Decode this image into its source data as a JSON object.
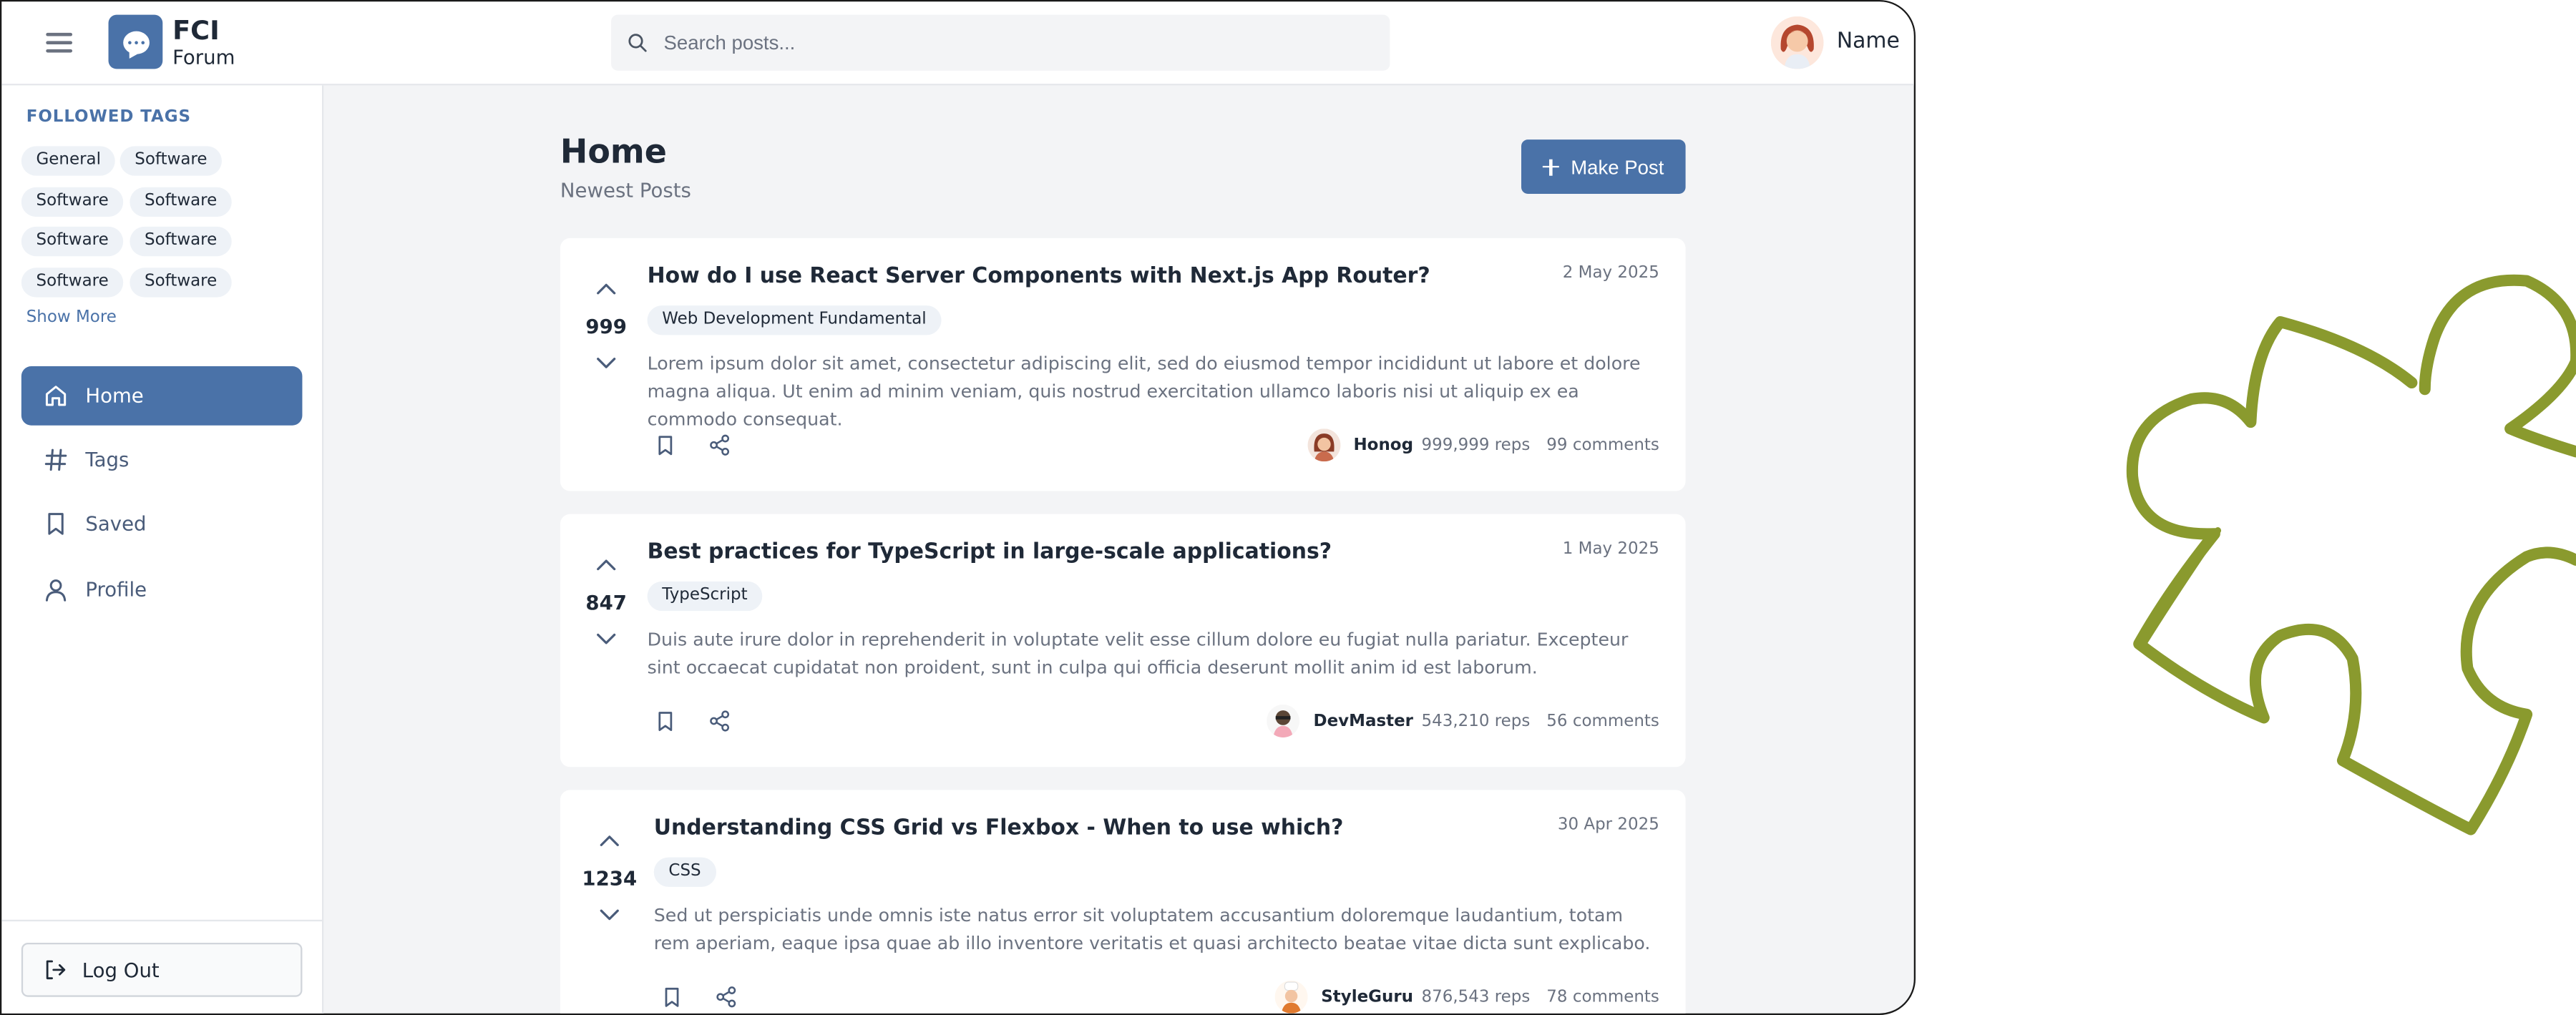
{
  "header": {
    "brand_main": "FCI",
    "brand_sub": "Forum",
    "search_placeholder": "Search posts...",
    "user_name": "Name"
  },
  "sidebar": {
    "followed_title": "FOLLOWED TAGS",
    "tags": [
      "General",
      "Software",
      "Software",
      "Software",
      "Software",
      "Software",
      "Software",
      "Software"
    ],
    "show_more": "Show More",
    "nav": [
      {
        "label": "Home",
        "icon": "home-icon",
        "active": true
      },
      {
        "label": "Tags",
        "icon": "hash-icon",
        "active": false
      },
      {
        "label": "Saved",
        "icon": "bookmark-icon",
        "active": false
      },
      {
        "label": "Profile",
        "icon": "user-icon",
        "active": false
      }
    ],
    "logout": "Log Out"
  },
  "main": {
    "title": "Home",
    "subtitle": "Newest Posts",
    "make_post": "Make Post"
  },
  "posts": [
    {
      "votes": "999",
      "title": "How do I use React Server Components with Next.js App Router?",
      "date": "2 May 2025",
      "tag": "Web Development Fundamental",
      "body": "Lorem ipsum dolor sit amet, consectetur adipiscing elit, sed do eiusmod tempor incididunt ut labore et dolore magna aliqua. Ut enim ad minim veniam, quis nostrud exercitation ullamco laboris nisi ut aliquip ex ea commodo consequat.",
      "author": "Honog",
      "reps": "999,999 reps",
      "comments": "99 comments"
    },
    {
      "votes": "847",
      "title": "Best practices for TypeScript in large-scale applications?",
      "date": "1 May 2025",
      "tag": "TypeScript",
      "body": "Duis aute irure dolor in reprehenderit in voluptate velit esse cillum dolore eu fugiat nulla pariatur. Excepteur sint occaecat cupidatat non proident, sunt in culpa qui officia deserunt mollit anim id est laborum.",
      "author": "DevMaster",
      "reps": "543,210 reps",
      "comments": "56 comments"
    },
    {
      "votes": "1234",
      "title": "Understanding CSS Grid vs Flexbox - When to use which?",
      "date": "30 Apr 2025",
      "tag": "CSS",
      "body": "Sed ut perspiciatis unde omnis iste natus error sit voluptatem accusantium doloremque laudantium, totam rem aperiam, eaque ipsa quae ab illo inventore veritatis et quasi architecto beatae vitae dicta sunt explicabo.",
      "author": "StyleGuru",
      "reps": "876,543 reps",
      "comments": "78 comments"
    }
  ],
  "colors": {
    "accent": "#4a72a8",
    "decor": "#8a9a2e"
  }
}
